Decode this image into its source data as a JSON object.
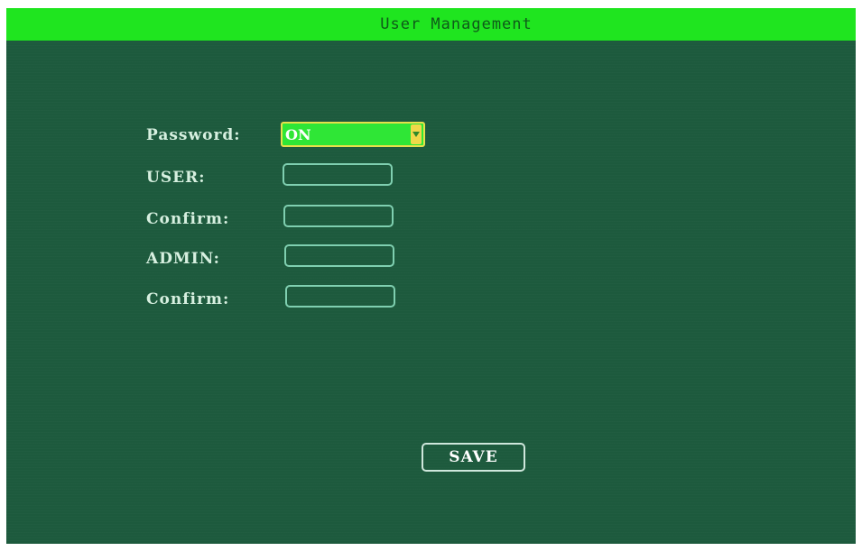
{
  "header": {
    "title": "User Management"
  },
  "form": {
    "password_label": "Password:",
    "password_value": "ON",
    "user_label": "USER:",
    "user_confirm_label": "Confirm:",
    "admin_label": "ADMIN:",
    "admin_confirm_label": "Confirm:",
    "user_value": "",
    "user_confirm_value": "",
    "admin_value": "",
    "admin_confirm_value": ""
  },
  "actions": {
    "save_label": "SAVE"
  },
  "colors": {
    "background": "#1d5a3d",
    "title_bar": "#1fe51f",
    "selected_field": "#2fe636",
    "field_border": "#7fcfb0",
    "dropdown_arrow": "#f0d84a"
  },
  "icons": {
    "dropdown": "chevron-down-icon"
  }
}
